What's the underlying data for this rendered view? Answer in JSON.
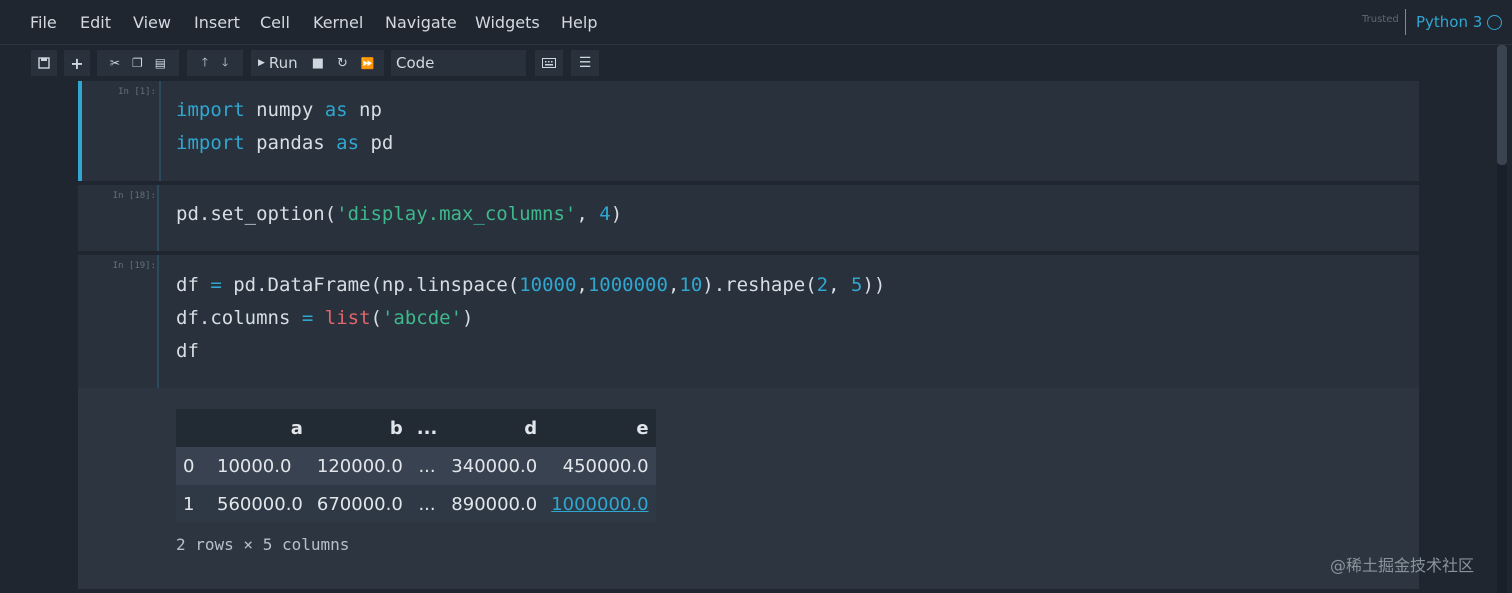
{
  "menu": [
    "File",
    "Edit",
    "View",
    "Insert",
    "Cell",
    "Kernel",
    "Navigate",
    "Widgets",
    "Help"
  ],
  "trusted": "Trusted",
  "kernel": "Python 3",
  "toolbar": {
    "run_label": "Run",
    "cell_type": "Code",
    "icons": [
      "save-icon",
      "plus-icon",
      "cut-icon",
      "copy-icon",
      "paste-icon",
      "arrow-up-icon",
      "arrow-down-icon",
      "run-icon",
      "stop-icon",
      "restart-icon",
      "fast-forward-icon",
      "keyboard-icon",
      "list-icon"
    ]
  },
  "cells": [
    {
      "prompt": "In [1]:",
      "lines": [
        "import numpy as np",
        "import pandas as pd"
      ]
    },
    {
      "prompt": "In [18]:",
      "lines": [
        "pd.set_option('display.max_columns', 4)"
      ]
    },
    {
      "prompt": "In [19]:",
      "lines": [
        "df = pd.DataFrame(np.linspace(10000,1000000,10).reshape(2, 5))",
        "df.columns = list('abcde')",
        "df"
      ]
    }
  ],
  "output": {
    "columns": [
      "",
      "a",
      "b",
      "...",
      "d",
      "e"
    ],
    "rows": [
      [
        "0",
        "10000.0",
        "120000.0",
        "...",
        "340000.0",
        "450000.0"
      ],
      [
        "1",
        "560000.0",
        "670000.0",
        "...",
        "890000.0",
        "1000000.0"
      ]
    ],
    "shape_note": "2 rows × 5 columns"
  },
  "watermark": "@稀土掘金技术社区",
  "colors": {
    "accent": "#2fa7d1",
    "string": "#3fb88c",
    "builtin": "#e0666b",
    "background": "#1f2630",
    "cell": "#28313c"
  }
}
